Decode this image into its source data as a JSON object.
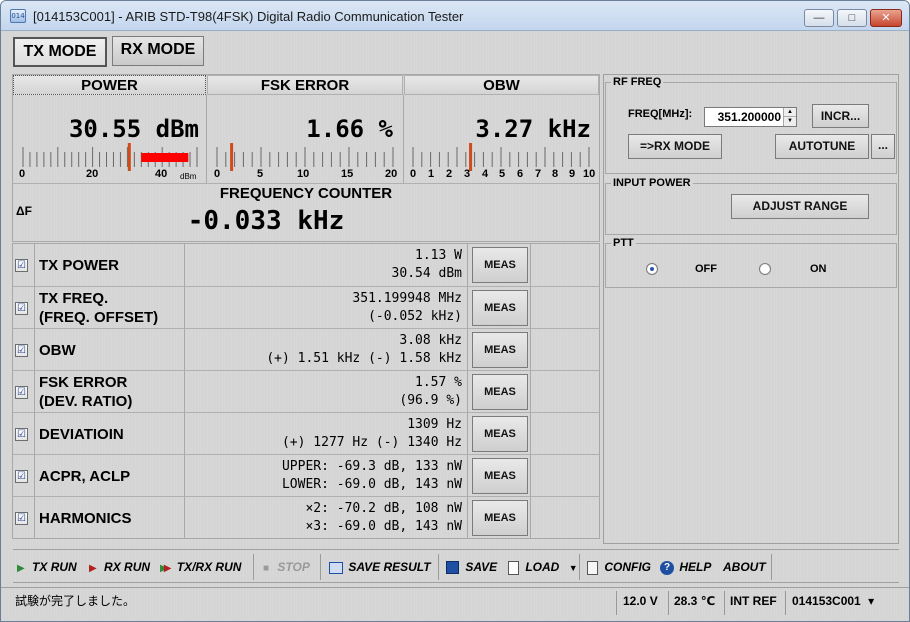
{
  "window": {
    "title": "[014153C001] - ARIB STD-T98(4FSK) Digital Radio Communication Tester",
    "icon_text": "014",
    "minimize_glyph": "—",
    "maximize_glyph": "□",
    "close_glyph": "✕"
  },
  "modes": {
    "tx": "TX MODE",
    "rx": "RX MODE",
    "active": "tx"
  },
  "meters": {
    "power": {
      "label": "POWER",
      "value": "30.55 dBm",
      "scale_labels": [
        "0",
        "20",
        "40"
      ],
      "unit": "dBm",
      "needle_value": 30.55,
      "scale_max": 50,
      "colors": {
        "needle": "#d04a1a",
        "alarm": "#ff0000"
      }
    },
    "fsk_error": {
      "label": "FSK ERROR",
      "value": "1.66 %",
      "scale_labels": [
        "0",
        "5",
        "10",
        "15",
        "20"
      ],
      "needle_value": 1.66,
      "scale_max": 20
    },
    "obw": {
      "label": "OBW",
      "value": "3.27 kHz",
      "scale_labels": [
        "0",
        "1",
        "2",
        "3",
        "4",
        "5",
        "6",
        "7",
        "8",
        "9",
        "10"
      ],
      "needle_value": 3.27,
      "scale_max": 10
    }
  },
  "frequency_counter": {
    "label": "FREQUENCY COUNTER",
    "delta_symbol": "ΔF",
    "value": "-0.033 kHz"
  },
  "measurements": [
    {
      "label1": "TX POWER",
      "label2": "",
      "val1": "1.13 W",
      "val2": "30.54 dBm",
      "checked": "☑",
      "meas": "MEAS"
    },
    {
      "label1": "TX FREQ.",
      "label2": "(FREQ. OFFSET)",
      "val1": "351.199948 MHz",
      "val2": "(-0.052 kHz)",
      "checked": "☑",
      "meas": "MEAS"
    },
    {
      "label1": "OBW",
      "label2": "",
      "val1": "3.08 kHz",
      "val2": "(+) 1.51 kHz (-) 1.58 kHz",
      "checked": "☑",
      "meas": "MEAS"
    },
    {
      "label1": "FSK ERROR",
      "label2": "(DEV. RATIO)",
      "val1": "1.57 %",
      "val2": "(96.9 %)",
      "checked": "☑",
      "meas": "MEAS"
    },
    {
      "label1": "DEVIATIOIN",
      "label2": "",
      "val1": "1309 Hz",
      "val2": "(+) 1277 Hz (-) 1340 Hz",
      "checked": "☑",
      "meas": "MEAS"
    },
    {
      "label1": "ACPR, ACLP",
      "label2": "",
      "val1": "UPPER: -69.3 dB, 133 nW",
      "val2": "LOWER: -69.0 dB, 143 nW",
      "checked": "☑",
      "meas": "MEAS"
    },
    {
      "label1": "HARMONICS",
      "label2": "",
      "val1": "×2: -70.2 dB, 108 nW",
      "val2": "×3: -69.0 dB, 143 nW",
      "checked": "☑",
      "meas": "MEAS"
    }
  ],
  "rf_freq": {
    "title": "RF FREQ",
    "freq_label": "FREQ[MHz]:",
    "freq_value": "351.200000",
    "incr": "INCR...",
    "rx_mode": "=>RX MODE",
    "autotune": "AUTOTUNE",
    "more": "..."
  },
  "input_power": {
    "title": "INPUT POWER",
    "adjust": "ADJUST RANGE"
  },
  "ptt": {
    "title": "PTT",
    "off": "OFF",
    "on": "ON",
    "selected": "off"
  },
  "toolbar": {
    "tx_run": "TX RUN",
    "rx_run": "RX RUN",
    "txrx_run": "TX/RX RUN",
    "stop": "STOP",
    "save_result": "SAVE RESULT",
    "save": "SAVE",
    "load": "LOAD",
    "config": "CONFIG",
    "help": "HELP",
    "about": "ABOUT"
  },
  "status": {
    "message": "試験が完了しました。",
    "voltage": "12.0 V",
    "temperature": "28.3 ℃",
    "ref": "INT REF",
    "device": "014153C001",
    "device_arrow": "▾"
  },
  "colors": {
    "play_green": "#2e8b3a",
    "play_red": "#b22020",
    "icon_blue": "#1f4fa3"
  }
}
